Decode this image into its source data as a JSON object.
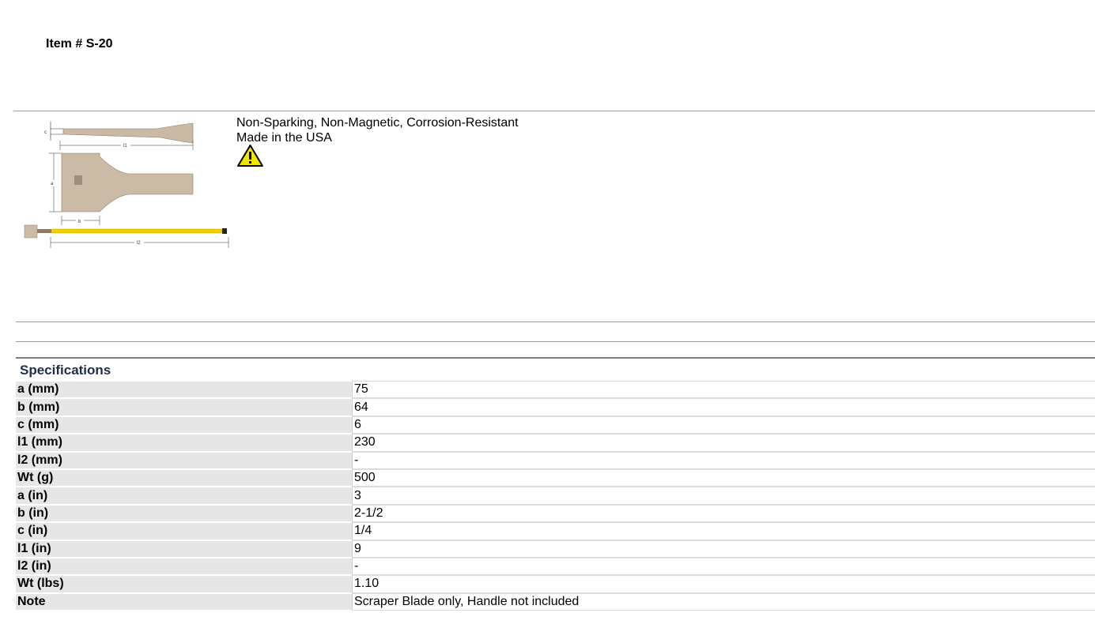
{
  "header": {
    "item_title": "Item # S-20"
  },
  "product": {
    "image_icon": "scraper-blade-diagram",
    "diagram_labels": {
      "c": "c",
      "l1": "l1",
      "a": "a",
      "b": "b",
      "l2": "l2"
    },
    "features": [
      "Non-Sparking, Non-Magnetic, Corrosion-Resistant",
      "Made in the USA"
    ],
    "warning_icon": "warning-triangle-icon"
  },
  "specifications": {
    "heading": "Specifications",
    "rows": [
      {
        "label": "a (mm)",
        "value": "75"
      },
      {
        "label": "b (mm)",
        "value": "64"
      },
      {
        "label": "c (mm)",
        "value": "6"
      },
      {
        "label": "l1 (mm)",
        "value": "230"
      },
      {
        "label": "l2 (mm)",
        "value": "-"
      },
      {
        "label": "Wt (g)",
        "value": "500"
      },
      {
        "label": "a (in)",
        "value": "3"
      },
      {
        "label": "b (in)",
        "value": "2-1/2"
      },
      {
        "label": "c (in)",
        "value": "1/4"
      },
      {
        "label": "l1 (in)",
        "value": "9"
      },
      {
        "label": "l2 (in)",
        "value": "-"
      },
      {
        "label": "Wt (lbs)",
        "value": "1.10"
      },
      {
        "label": "Note",
        "value": "Scraper Blade only, Handle not included"
      }
    ]
  },
  "colors": {
    "heading": "#1f2d4d",
    "label_bg": "#e6e6e6",
    "warning_yellow": "#f2e600"
  }
}
